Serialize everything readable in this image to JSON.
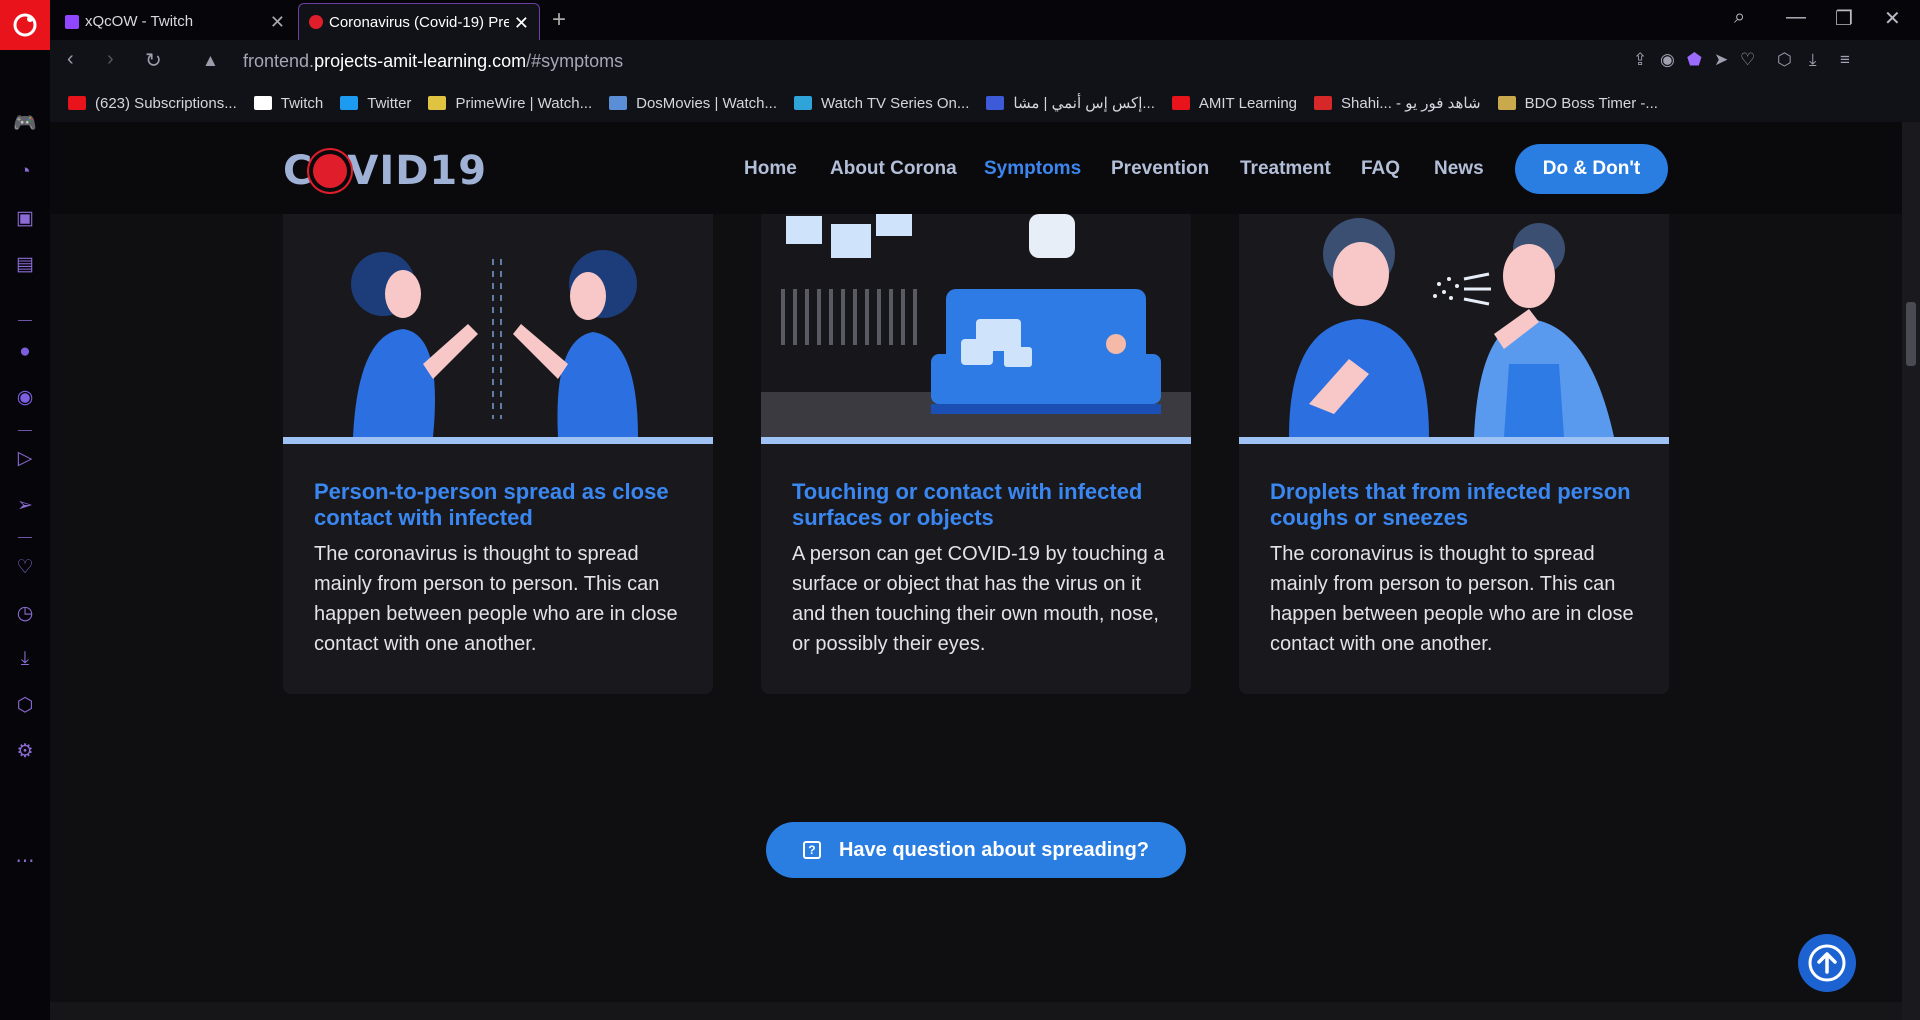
{
  "tabs": [
    {
      "label": "xQcOW - Twitch"
    },
    {
      "label": "Coronavirus (Covid-19) Pre"
    }
  ],
  "address": {
    "prefix": "frontend.",
    "domain": "projects-amit-learning.com",
    "suffix": "/#symptoms"
  },
  "bookmarks": [
    {
      "label": "(623) Subscriptions...",
      "icon": "youtube-icon",
      "color": "#e8131b"
    },
    {
      "label": "Twitch",
      "icon": "page-icon",
      "color": "#ffffff"
    },
    {
      "label": "Twitter",
      "icon": "twitter-icon",
      "color": "#1d9bf0"
    },
    {
      "label": "PrimeWire | Watch...",
      "icon": "primewire-icon",
      "color": "#e0c341"
    },
    {
      "label": "DosMovies | Watch...",
      "icon": "dosmovies-icon",
      "color": "#5a8fd8"
    },
    {
      "label": "Watch TV Series On...",
      "icon": "watchtv-icon",
      "color": "#2fa4d9"
    },
    {
      "label": "إكس إس أنمي | مشا...",
      "icon": "xs-icon",
      "color": "#3d5bd8"
    },
    {
      "label": "AMIT Learning",
      "icon": "amit-icon",
      "color": "#e8131b"
    },
    {
      "label": "Shahi... - شاهد فور يو",
      "icon": "shahid-icon",
      "color": "#d62828"
    },
    {
      "label": "BDO Boss Timer -...",
      "icon": "bdo-icon",
      "color": "#c9a94b"
    }
  ],
  "site": {
    "logo_left": "C",
    "logo_right": "VID19",
    "nav": [
      "Home",
      "About Corona",
      "Symptoms",
      "Prevention",
      "Treatment",
      "FAQ",
      "News"
    ],
    "active_nav": "Symptoms",
    "cta": "Do & Don't"
  },
  "cards": [
    {
      "title": "Person-to-person spread as close contact with infected",
      "text": "The coronavirus is thought to spread mainly from person to person. This can happen between people who are in close contact with one another."
    },
    {
      "title": "Touching or contact with infected surfaces or objects",
      "text": "A person can get COVID-19 by touching a surface or object that has the virus on it and then touching their own mouth, nose, or possibly their eyes."
    },
    {
      "title": "Droplets that from infected person coughs or sneezes",
      "text": "The coronavirus is thought to spread mainly from person to person. This can happen between people who are in close contact with one another."
    }
  ],
  "question_button": "Have question about spreading?",
  "colors": {
    "accent": "#2a7de1",
    "title": "#3a87f2",
    "opera_red": "#e8131b",
    "sidebar_icon": "#8d6bd6"
  }
}
